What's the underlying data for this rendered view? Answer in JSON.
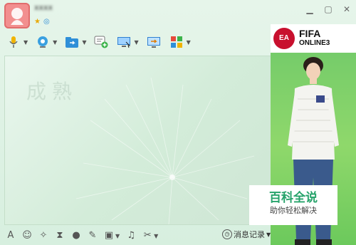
{
  "titlebar": {
    "nickname": "xxxx",
    "minimize_icon": "minimize-icon",
    "maximize_icon": "maximize-icon",
    "close_icon": "close-icon"
  },
  "toolbar": {
    "tools": [
      "microphone-icon",
      "webcam-icon",
      "file-transfer-icon",
      "add-chat-icon",
      "remote-desktop-icon",
      "screen-share-icon",
      "apps-grid-icon"
    ]
  },
  "chat": {
    "watermark": "成熟"
  },
  "ad": {
    "ea_label": "EA",
    "title_line1": "FIFA",
    "title_line2": "ONLINE3"
  },
  "baike": {
    "main": "百科全说",
    "sub": "助你轻松解决"
  },
  "bottombar": {
    "font_label": "A",
    "history_label": "消息记录"
  },
  "colors": {
    "accent_green": "#27a36b",
    "avatar_bg": "#f28f8f",
    "ad_green": "#6ec86a"
  }
}
